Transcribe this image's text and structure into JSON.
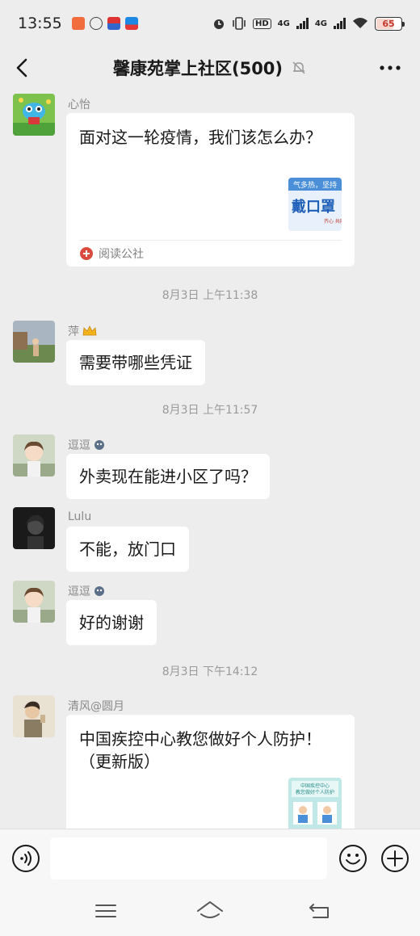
{
  "status_bar": {
    "time": "13:55",
    "battery": "65",
    "network_1": "4G",
    "network_2": "4G",
    "hd_label": "HD"
  },
  "header": {
    "title": "馨康苑掌上社区(500)"
  },
  "messages": [
    {
      "kind": "card",
      "sender": "心怡",
      "title": "面对这一轮疫情，我们该怎么办？",
      "thumb_lines": [
        "气多热，坚持",
        "戴口罩",
        "齐心 共同 护筑"
      ],
      "source": "阅读公社"
    },
    {
      "kind": "time",
      "text": "8月3日 上午11:38"
    },
    {
      "kind": "text",
      "sender": "萍",
      "text": "需要带哪些凭证"
    },
    {
      "kind": "time",
      "text": "8月3日 上午11:57"
    },
    {
      "kind": "text",
      "sender": "逗逗",
      "text": "外卖现在能进小区了吗？"
    },
    {
      "kind": "text",
      "sender": "Lulu",
      "text": "不能，放门口"
    },
    {
      "kind": "text",
      "sender": "逗逗",
      "text": "好的谢谢"
    },
    {
      "kind": "time",
      "text": "8月3日 下午14:12"
    },
    {
      "kind": "card",
      "sender": "清风@圆月",
      "title": "中国疾控中心教您做好个人防护！（更新版）",
      "thumb_lines": [
        "中国疾控中心",
        "教您做好个人防护"
      ]
    }
  ],
  "input": {
    "placeholder": "",
    "value": ""
  },
  "colors": {
    "background": "#ededed",
    "bubble": "#ffffff",
    "bottom_bar": "#f7f7f7",
    "secondary_text": "#8a8a8a"
  },
  "icons": {
    "back": "chevron-left-icon",
    "mute": "bell-off-icon",
    "more": "more-dots-icon",
    "voice": "voice-icon",
    "emoji": "emoji-icon",
    "plus": "plus-icon",
    "menu": "menu-icon",
    "home": "home-icon",
    "return": "return-icon"
  }
}
